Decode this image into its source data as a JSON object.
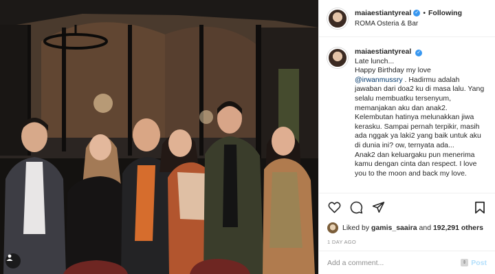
{
  "post": {
    "username": "maiaestiantyreal",
    "location": "ROMA Osteria & Bar",
    "follow_label": "Following",
    "separator": "•"
  },
  "caption": {
    "username": "maiaestiantyreal",
    "line1": "Late lunch...",
    "line2": "Happy Birthday my love",
    "mention": "@irwanmussry",
    "body1": " . Hadirmu adalah jawaban dari doa2 ku di masa lalu. Yang selalu membuatku tersenyum, memanjakan aku dan anak2. Kelembutan hatinya melunakkan jiwa kerasku. Sampai pernah terpikir, masih ada nggak ya laki2 yang baik untuk aku di dunia ini? ow, ternyata ada...",
    "body2": "Anak2 dan keluargaku pun menerima kamu dengan cinta dan respect. I love you to the moon and back my love."
  },
  "likes": {
    "prefix": "Liked by ",
    "user": "gamis_saaira",
    "middle": " and ",
    "count": "192,291 others"
  },
  "timestamp": "1 DAY AGO",
  "comment": {
    "placeholder": "Add a comment...",
    "post_label": "Post"
  },
  "icons": {
    "like": "heart-icon",
    "comment": "comment-icon",
    "share": "share-icon",
    "save": "bookmark-icon",
    "verified": "verified-badge-icon",
    "tagged": "tagged-users-icon",
    "emoji": "emoji-icon"
  },
  "colors": {
    "verified": "#3897f0",
    "mention": "#00376b",
    "post_disabled": "#b2dffc",
    "muted": "#8e8e8e"
  }
}
